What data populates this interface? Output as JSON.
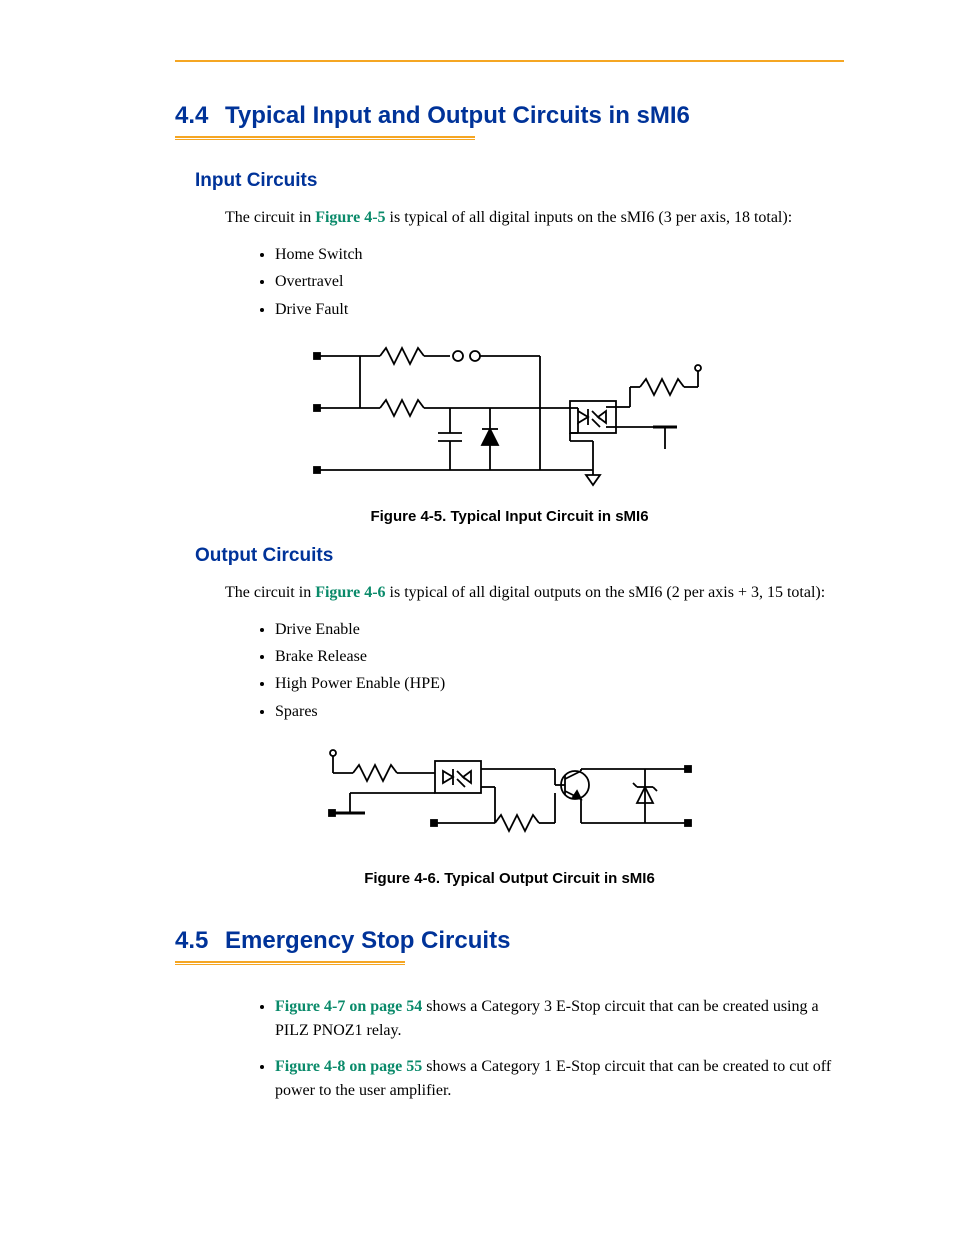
{
  "section44": {
    "num": "4.4",
    "title": "Typical Input and Output Circuits in sMI6"
  },
  "input_circuits": {
    "heading": "Input Circuits",
    "intro_pre": "The circuit in ",
    "intro_link": "Figure 4-5",
    "intro_post": " is typical of all digital inputs on the sMI6 (3 per axis, 18 total):",
    "items": [
      "Home Switch",
      "Overtravel",
      "Drive Fault"
    ],
    "caption": "Figure 4-5. Typical Input Circuit in sMI6"
  },
  "output_circuits": {
    "heading": "Output Circuits",
    "intro_pre": "The circuit in ",
    "intro_link": "Figure 4-6",
    "intro_post": " is typical of all digital outputs on the sMI6 (2 per axis + 3, 15 total):",
    "items": [
      "Drive Enable",
      "Brake Release",
      "High Power Enable (HPE)",
      "Spares"
    ],
    "caption": "Figure 4-6. Typical Output Circuit in sMI6"
  },
  "section45": {
    "num": "4.5",
    "title": "Emergency Stop Circuits",
    "refs": [
      {
        "link": "Figure 4-7 on page 54",
        "rest": " shows a Category 3 E-Stop circuit that can be created using a PILZ PNOZ1 relay."
      },
      {
        "link": "Figure 4-8 on page 55",
        "rest": " shows a Category 1 E-Stop circuit that can be created to cut off power to the user amplifier."
      }
    ]
  }
}
